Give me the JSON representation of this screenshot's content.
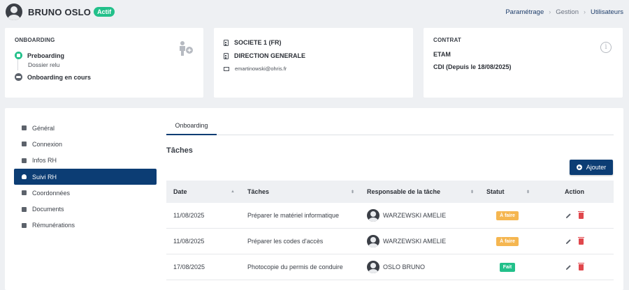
{
  "header": {
    "user_name": "BRUNO OSLO",
    "status_badge": "Actif",
    "breadcrumb": [
      "Paramétrage",
      "Gestion",
      "Utilisateurs"
    ]
  },
  "onboarding_card": {
    "title": "ONBOARDING",
    "steps": [
      {
        "label": "Preboarding",
        "sub": "Dossier relu"
      },
      {
        "label": "Onboarding en cours"
      }
    ]
  },
  "company_card": {
    "company": "SOCIETE 1 (FR)",
    "direction": "DIRECTION GENERALE",
    "email": "emartinowski@ohris.fr"
  },
  "contract_card": {
    "title": "CONTRAT",
    "type": "ETAM",
    "detail": "CDI (Depuis le 18/08/2025)"
  },
  "sidebar": {
    "items": [
      {
        "label": "Général",
        "icon": "dashboard-icon"
      },
      {
        "label": "Connexion",
        "icon": "lock-icon"
      },
      {
        "label": "Infos RH",
        "icon": "document-icon"
      },
      {
        "label": "Suivi RH",
        "icon": "handshake-icon",
        "active": true
      },
      {
        "label": "Coordonnées",
        "icon": "contact-icon"
      },
      {
        "label": "Documents",
        "icon": "folder-icon"
      },
      {
        "label": "Rémunérations",
        "icon": "payment-icon"
      }
    ]
  },
  "main": {
    "tab": "Onboarding",
    "section_title": "Tâches",
    "add_button": "Ajouter",
    "table": {
      "headers": [
        "Date",
        "Tâches",
        "Responsable de la tâche",
        "Statut",
        "Action"
      ],
      "rows": [
        {
          "date": "11/08/2025",
          "task": "Préparer le matériel informatique",
          "owner": "WARZEWSKI AMELIE",
          "status": "À faire"
        },
        {
          "date": "11/08/2025",
          "task": "Préparer les codes d'accès",
          "owner": "WARZEWSKI AMELIE",
          "status": "À faire"
        },
        {
          "date": "17/08/2025",
          "task": "Photocopie du permis de conduire",
          "owner": "OSLO BRUNO",
          "status": "Fait"
        }
      ]
    }
  },
  "colors": {
    "primary": "#0c3d74",
    "success": "#22c08a",
    "todo": "#f5b650",
    "delete": "#e0474c"
  }
}
